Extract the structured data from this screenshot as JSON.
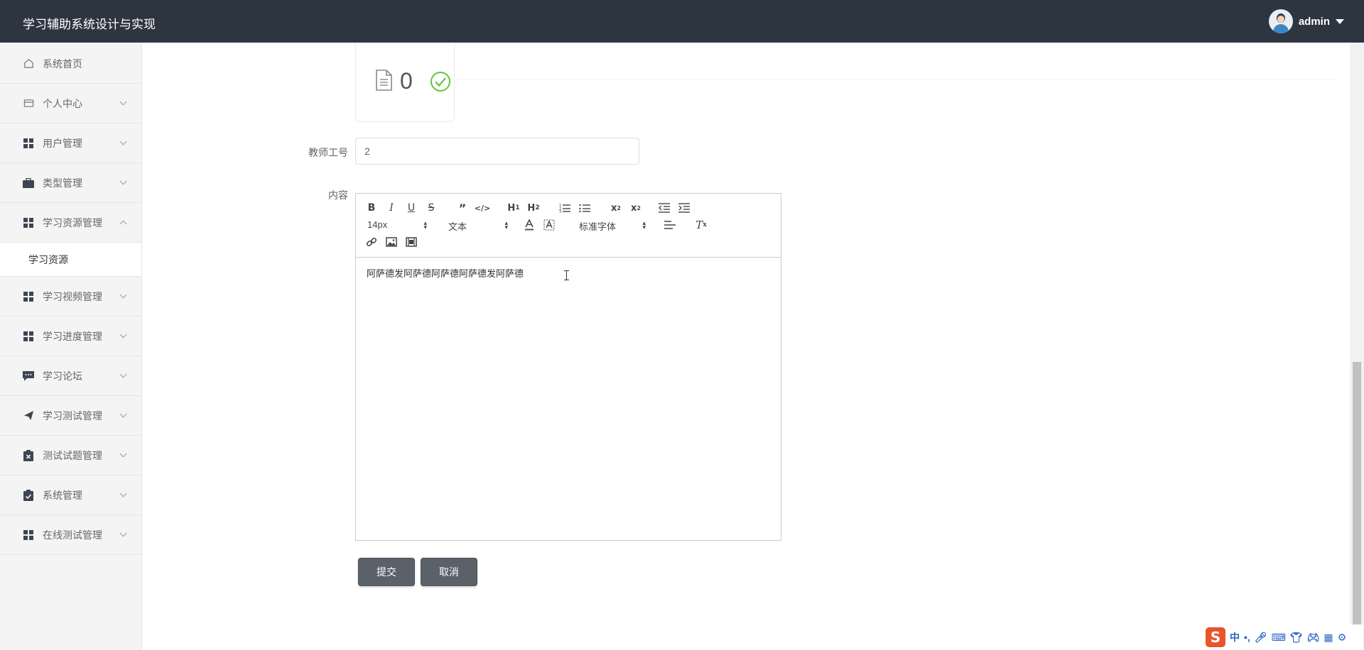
{
  "header": {
    "app_title": "学习辅助系统设计与实现",
    "user_name": "admin"
  },
  "sidebar": {
    "items": [
      {
        "label": "系统首页",
        "icon": "home-icon",
        "has_chevron": false
      },
      {
        "label": "个人中心",
        "icon": "card-icon",
        "has_chevron": true
      },
      {
        "label": "用户管理",
        "icon": "grid-icon",
        "has_chevron": true
      },
      {
        "label": "类型管理",
        "icon": "briefcase-icon",
        "has_chevron": true
      },
      {
        "label": "学习资源管理",
        "icon": "grid-icon",
        "has_chevron": true,
        "expanded": true
      },
      {
        "label": "学习视频管理",
        "icon": "grid-icon",
        "has_chevron": true
      },
      {
        "label": "学习进度管理",
        "icon": "grid-icon",
        "has_chevron": true
      },
      {
        "label": "学习论坛",
        "icon": "chat-icon",
        "has_chevron": true
      },
      {
        "label": "学习测试管理",
        "icon": "paper-plane-icon",
        "has_chevron": true
      },
      {
        "label": "测试试题管理",
        "icon": "clipboard-x-icon",
        "has_chevron": true
      },
      {
        "label": "系统管理",
        "icon": "clipboard-check-icon",
        "has_chevron": true
      },
      {
        "label": "在线测试管理",
        "icon": "grid-icon",
        "has_chevron": true
      }
    ],
    "sub_item": {
      "label": "学习资源"
    }
  },
  "form": {
    "file_count": "0",
    "teacher_id_label": "教师工号",
    "teacher_id_value": "2",
    "content_label": "内容",
    "content_text": "阿萨德发阿萨德阿萨德阿萨德发阿萨德",
    "submit_label": "提交",
    "cancel_label": "取消"
  },
  "editor_toolbar": {
    "font_size": "14px",
    "header_select": "文本",
    "font_family": "标准字体",
    "buttons": [
      "bold",
      "italic",
      "underline",
      "strike",
      "blockquote",
      "code-block",
      "h1",
      "h2",
      "ordered-list",
      "bullet-list",
      "subscript",
      "superscript",
      "outdent",
      "indent",
      "text-color",
      "background-color",
      "align",
      "clean",
      "link",
      "image",
      "video"
    ]
  },
  "ime": {
    "lang": "中"
  },
  "colors": {
    "header_bg": "#2d3541",
    "button_bg": "#5a6169",
    "sidebar_bg": "#f4f4f5",
    "success": "#67c23a"
  }
}
